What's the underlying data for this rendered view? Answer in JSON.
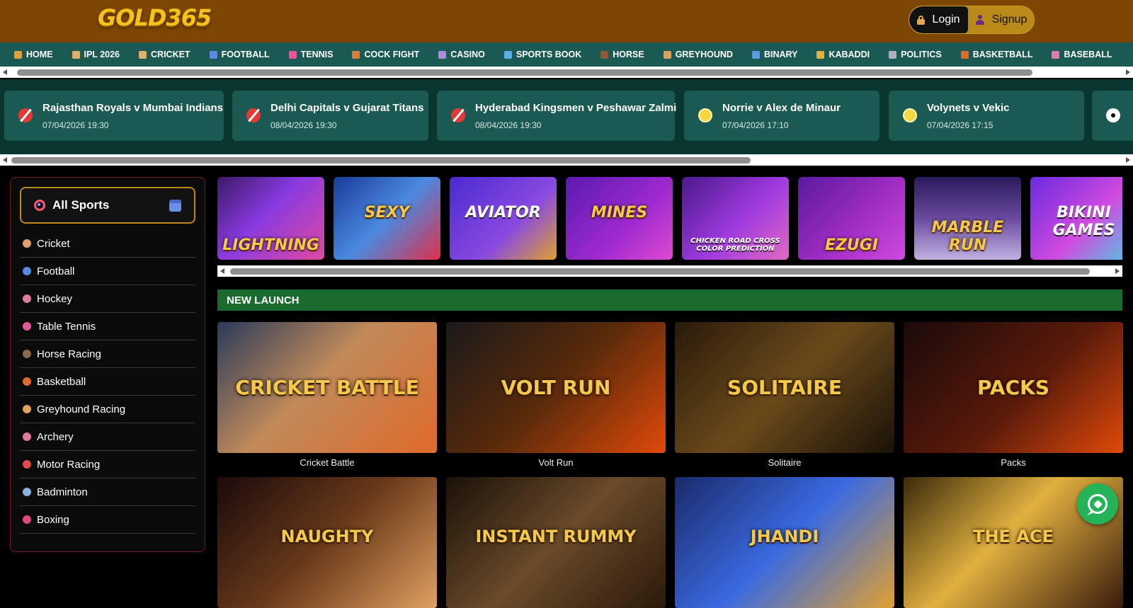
{
  "header": {
    "logo": "GOLD365",
    "login_label": "Login",
    "signup_label": "Signup"
  },
  "nav": [
    {
      "label": "HOME",
      "icon": "home-icon",
      "color": "#d9a441"
    },
    {
      "label": "IPL 2026",
      "icon": "cricket-bat-icon",
      "color": "#e0b070"
    },
    {
      "label": "CRICKET",
      "icon": "cricket-bat-icon",
      "color": "#e0b070"
    },
    {
      "label": "FOOTBALL",
      "icon": "football-icon",
      "color": "#5a8ae0"
    },
    {
      "label": "TENNIS",
      "icon": "tennis-racket-icon",
      "color": "#e05a9a"
    },
    {
      "label": "COCK FIGHT",
      "icon": "rooster-icon",
      "color": "#e07a3a"
    },
    {
      "label": "CASINO",
      "icon": "casino-icon",
      "color": "#b08ae0"
    },
    {
      "label": "SPORTS BOOK",
      "icon": "book-icon",
      "color": "#5ab0e0"
    },
    {
      "label": "HORSE",
      "icon": "horse-icon",
      "color": "#8a5a3a"
    },
    {
      "label": "GREYHOUND",
      "icon": "greyhound-icon",
      "color": "#e0a05a"
    },
    {
      "label": "BINARY",
      "icon": "bar-chart-icon",
      "color": "#5a9ae0"
    },
    {
      "label": "KABADDI",
      "icon": "kabaddi-icon",
      "color": "#e0b040"
    },
    {
      "label": "POLITICS",
      "icon": "building-icon",
      "color": "#aab0c0"
    },
    {
      "label": "BASKETBALL",
      "icon": "basketball-icon",
      "color": "#e06a2a"
    },
    {
      "label": "BASEBALL",
      "icon": "baseball-icon",
      "color": "#e07ab0"
    }
  ],
  "events": [
    {
      "title": "Rajasthan Royals v Mumbai Indians",
      "date": "07/04/2026 19:30",
      "icon": "cricket-icon",
      "kind": "cricket"
    },
    {
      "title": "Delhi Capitals v Gujarat Titans",
      "date": "08/04/2026 19:30",
      "icon": "cricket-icon",
      "kind": "cricket"
    },
    {
      "title": "Hyderabad Kingsmen v Peshawar Zalmi",
      "date": "08/04/2026 19:30",
      "icon": "cricket-icon",
      "kind": "cricket"
    },
    {
      "title": "Norrie v Alex de Minaur",
      "date": "07/04/2026 17:10",
      "icon": "tennis-ball-icon",
      "kind": "tennis"
    },
    {
      "title": "Volynets v Vekic",
      "date": "07/04/2026 17:15",
      "icon": "tennis-ball-icon",
      "kind": "tennis"
    },
    {
      "title": "",
      "date": "",
      "icon": "football-icon",
      "kind": "ball"
    }
  ],
  "sidebar": {
    "header_label": "All Sports",
    "items": [
      {
        "label": "Cricket",
        "icon": "cricket-bat-icon",
        "color": "#e0a070"
      },
      {
        "label": "Football",
        "icon": "football-icon",
        "color": "#5a8ae0"
      },
      {
        "label": "Hockey",
        "icon": "hockey-stick-icon",
        "color": "#e07aa0"
      },
      {
        "label": "Table Tennis",
        "icon": "table-tennis-icon",
        "color": "#e05a9a"
      },
      {
        "label": "Horse Racing",
        "icon": "horse-racing-icon",
        "color": "#8a6a4a"
      },
      {
        "label": "Basketball",
        "icon": "basketball-icon",
        "color": "#e06a2a"
      },
      {
        "label": "Greyhound Racing",
        "icon": "greyhound-icon",
        "color": "#e0a05a"
      },
      {
        "label": "Archery",
        "icon": "archery-icon",
        "color": "#e07a9a"
      },
      {
        "label": "Motor Racing",
        "icon": "motor-racing-icon",
        "color": "#e04a4a"
      },
      {
        "label": "Badminton",
        "icon": "badminton-icon",
        "color": "#8ab0e0"
      },
      {
        "label": "Boxing",
        "icon": "boxing-glove-icon",
        "color": "#e04a7a"
      }
    ]
  },
  "casino_row": [
    {
      "label": "LIGHTNING",
      "bg": "linear-gradient(135deg,#3a1a6a,#8a3ae0 45%,#e04aa0)",
      "style": "gold"
    },
    {
      "label": "SEXY",
      "bg": "linear-gradient(135deg,#1a3a9a,#4a8ae0 50%,#e0304a)",
      "style": "gold-mid"
    },
    {
      "label": "AVIATOR",
      "bg": "linear-gradient(135deg,#4a2ad0,#8a4ae0 60%,#e0a030)",
      "style": "white-mid"
    },
    {
      "label": "MINES",
      "bg": "linear-gradient(135deg,#5a1ab0,#a02ad0 60%,#e04ad0)",
      "style": "gold-mid"
    },
    {
      "label": "CHICKEN ROAD CROSS   COLOR PREDICTION",
      "bg": "linear-gradient(135deg,#4a1a8a,#a03ae0 55%,#e06ac0)",
      "style": "small"
    },
    {
      "label": "EZUGI",
      "bg": "linear-gradient(135deg,#5a1aa0,#9a2ac0 50%,#d04ae0)",
      "style": "gold"
    },
    {
      "label": "MARBLE RUN",
      "bg": "linear-gradient(180deg,#2a1a5a,#6a4aa0 50%,#c0b0e0)",
      "style": "gold"
    },
    {
      "label": "BIKINI GAMES",
      "bg": "linear-gradient(135deg,#6a2ae0,#d04ae0 55%,#4ad0e0)",
      "style": "white-mid"
    }
  ],
  "new_launch": {
    "title": "NEW LAUNCH",
    "games": [
      {
        "name": "Cricket Battle",
        "art": "CRICKET BATTLE",
        "bg": "linear-gradient(135deg,#2a3a5a,#c08a5a 45%,#e06a2a)"
      },
      {
        "name": "Volt Run",
        "art": "VOLT RUN",
        "bg": "linear-gradient(135deg,#1a1a1a,#5a2a0a 50%,#e04a0a)"
      },
      {
        "name": "Solitaire",
        "art": "SOLITAIRE",
        "bg": "linear-gradient(135deg,#2a1a0a,#6a4a1a 50%,#1a1208)"
      },
      {
        "name": "Packs",
        "art": "PACKS",
        "bg": "linear-gradient(135deg,#1a0a0a,#5a1a0a 55%,#e04a0a)"
      },
      {
        "name": "",
        "art": "NAUGHTY",
        "bg": "linear-gradient(135deg,#1a0a0a,#6a3a1a 50%,#e0a060)"
      },
      {
        "name": "",
        "art": "INSTANT RUMMY",
        "bg": "linear-gradient(135deg,#1a1208,#6a4a2a 50%,#2a1a0a)"
      },
      {
        "name": "",
        "art": "JHANDI",
        "bg": "linear-gradient(135deg,#1a2a6a,#3a6ae0 50%,#e0a030)"
      },
      {
        "name": "",
        "art": "THE ACE",
        "bg": "linear-gradient(135deg,#3a2a0a,#e0b040 45%,#3a1a0a)"
      }
    ]
  }
}
